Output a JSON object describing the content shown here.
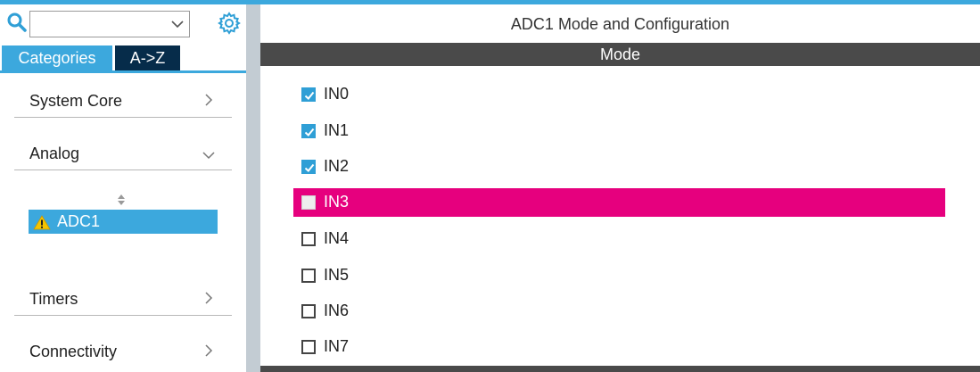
{
  "search": {
    "placeholder": "",
    "value": ""
  },
  "tabs": [
    {
      "label": "Categories",
      "active": true
    },
    {
      "label": "A->Z",
      "active": false
    }
  ],
  "categories": [
    {
      "label": "System Core",
      "expanded": false
    },
    {
      "label": "Analog",
      "expanded": true,
      "children": [
        {
          "label": "ADC1",
          "status": "warning",
          "selected": true
        }
      ]
    },
    {
      "label": "Timers",
      "expanded": false
    },
    {
      "label": "Connectivity",
      "expanded": false
    }
  ],
  "panel": {
    "title": "ADC1 Mode and Configuration",
    "section": "Mode",
    "inputs": [
      {
        "label": "IN0",
        "checked": true
      },
      {
        "label": "IN1",
        "checked": true
      },
      {
        "label": "IN2",
        "checked": true
      },
      {
        "label": "IN3",
        "checked": false,
        "highlighted": true
      },
      {
        "label": "IN4",
        "checked": false
      },
      {
        "label": "IN5",
        "checked": false
      },
      {
        "label": "IN6",
        "checked": false
      },
      {
        "label": "IN7",
        "checked": false
      }
    ]
  },
  "colors": {
    "accent": "#3ca8dd",
    "tab_dark": "#062c4a",
    "highlight": "#e6007e",
    "header_bar": "#4a4a4a",
    "warning": "#f5c400"
  }
}
